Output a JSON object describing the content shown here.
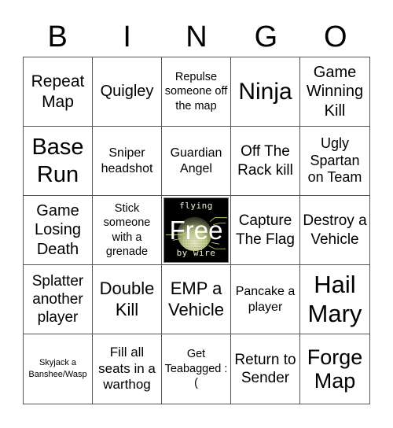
{
  "title_letters": [
    "B",
    "I",
    "N",
    "G",
    "O"
  ],
  "free_space": {
    "label": "Free",
    "image_top_text": "flying",
    "image_bottom_text": "by wire",
    "colors": {
      "background": "#000000",
      "sphere_light": "#f2f7c8",
      "sphere_dark": "#5a5a3a",
      "wire": "#c8e07a"
    }
  },
  "cells": [
    [
      "Repeat Map",
      "Quigley",
      "Repulse someone off the map",
      "Ninja",
      "Game Winning Kill"
    ],
    [
      "Base Run",
      "Sniper headshot",
      "Guardian Angel",
      "Off The Rack kill",
      "Ugly Spartan on Team"
    ],
    [
      "Game Losing Death",
      "Stick someone with a grenade",
      "Free",
      "Capture The Flag",
      "Destroy a Vehicle"
    ],
    [
      "Splatter another player",
      "Double Kill",
      "EMP a Vehicle",
      "Pancake a player",
      "Hail Mary"
    ],
    [
      "Skyjack a Banshee/Wasp",
      "Fill all seats in a warthog",
      "Get Teabagged :(",
      "Return to Sender",
      "Forge Map"
    ]
  ]
}
